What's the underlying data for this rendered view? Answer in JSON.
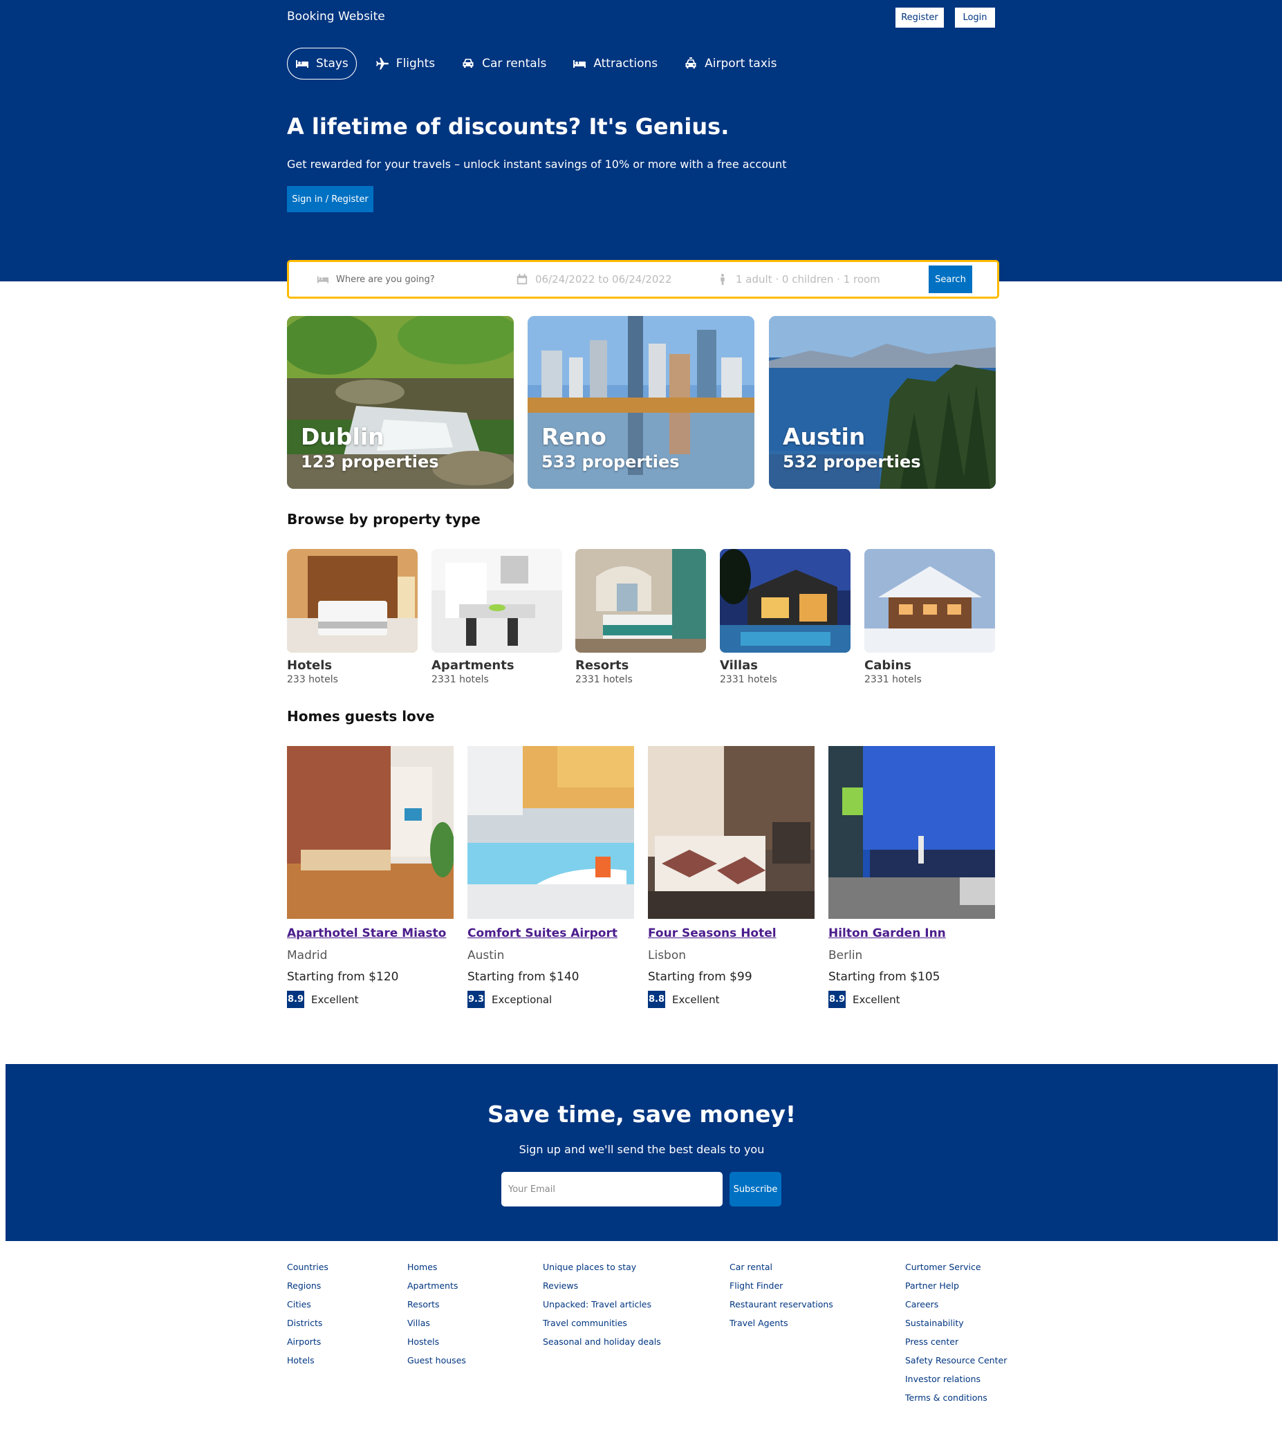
{
  "header": {
    "logo": "Booking Website",
    "register_label": "Register",
    "login_label": "Login",
    "nav": [
      {
        "label": "Stays",
        "icon": "bed-icon",
        "active": true
      },
      {
        "label": "Flights",
        "icon": "plane-icon",
        "active": false
      },
      {
        "label": "Car rentals",
        "icon": "car-icon",
        "active": false
      },
      {
        "label": "Attractions",
        "icon": "bed-icon",
        "active": false
      },
      {
        "label": "Airport taxis",
        "icon": "taxi-icon",
        "active": false
      }
    ],
    "hero_title": "A lifetime of discounts? It's Genius.",
    "hero_subtitle": "Get rewarded for your travels – unlock instant savings of 10% or more with a free account",
    "signin_label": "Sign in / Register"
  },
  "search": {
    "destination_placeholder": "Where are you going?",
    "dates": "06/24/2022 to 06/24/2022",
    "occupancy": "1 adult · 0 children · 1 room",
    "button_label": "Search"
  },
  "featured": [
    {
      "city": "Dublin",
      "properties": "123 properties"
    },
    {
      "city": "Reno",
      "properties": "533 properties"
    },
    {
      "city": "Austin",
      "properties": "532 properties"
    }
  ],
  "property_types": {
    "title": "Browse by property type",
    "items": [
      {
        "name": "Hotels",
        "count": "233 hotels"
      },
      {
        "name": "Apartments",
        "count": "2331 hotels"
      },
      {
        "name": "Resorts",
        "count": "2331 hotels"
      },
      {
        "name": "Villas",
        "count": "2331 hotels"
      },
      {
        "name": "Cabins",
        "count": "2331 hotels"
      }
    ]
  },
  "homes": {
    "title": "Homes guests love",
    "items": [
      {
        "name": "Aparthotel Stare Miasto",
        "city": "Madrid",
        "price": "Starting from $120",
        "score": "8.9",
        "rating": "Excellent"
      },
      {
        "name": "Comfort Suites Airport",
        "city": "Austin",
        "price": "Starting from $140",
        "score": "9.3",
        "rating": "Exceptional"
      },
      {
        "name": "Four Seasons Hotel",
        "city": "Lisbon",
        "price": "Starting from $99",
        "score": "8.8",
        "rating": "Excellent"
      },
      {
        "name": "Hilton Garden Inn",
        "city": "Berlin",
        "price": "Starting from $105",
        "score": "8.9",
        "rating": "Excellent"
      }
    ]
  },
  "newsletter": {
    "title": "Save time, save money!",
    "subtitle": "Sign up and we'll send the best deals to you",
    "email_placeholder": "Your Email",
    "button_label": "Subscribe"
  },
  "footer": {
    "columns": [
      [
        "Countries",
        "Regions",
        "Cities",
        "Districts",
        "Airports",
        "Hotels"
      ],
      [
        "Homes",
        "Apartments",
        "Resorts",
        "Villas",
        "Hostels",
        "Guest houses"
      ],
      [
        "Unique places to stay",
        "Reviews",
        "Unpacked: Travel articles",
        "Travel communities",
        "Seasonal and holiday deals"
      ],
      [
        "Car rental",
        "Flight Finder",
        "Restaurant reservations",
        "Travel Agents"
      ],
      [
        "Curtomer Service",
        "Partner Help",
        "Careers",
        "Sustainability",
        "Press center",
        "Safety Resource Center",
        "Investor relations",
        "Terms & conditions"
      ]
    ]
  },
  "colors": {
    "brand": "#003580",
    "accent": "#0071c2",
    "search_border": "#febb02",
    "link": "#4b1d8c"
  }
}
